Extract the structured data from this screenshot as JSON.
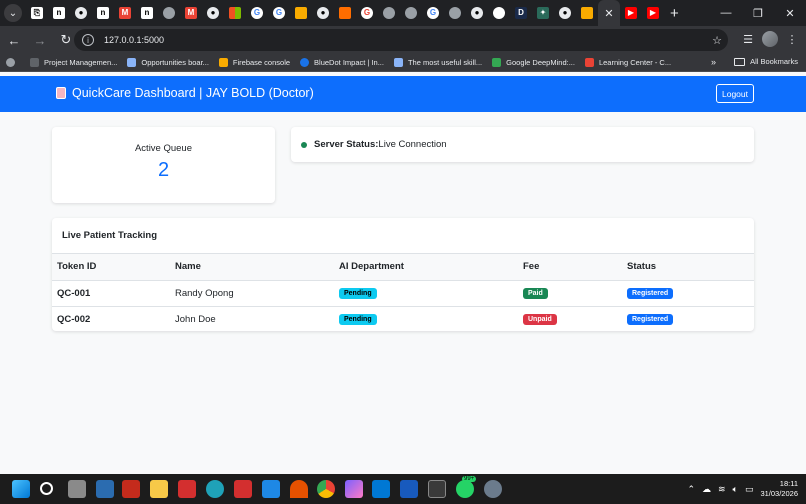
{
  "browser": {
    "url": "127.0.0.1:5000",
    "bookmarks": [
      {
        "label": "Project Managemen...",
        "color": "#5f6368"
      },
      {
        "label": "Opportunities boar...",
        "color": "#8ab4f8"
      },
      {
        "label": "Firebase console",
        "color": "#f9ab00"
      },
      {
        "label": "BlueDot Impact | In...",
        "color": "#1a73e8"
      },
      {
        "label": "The most useful skill...",
        "color": "#8ab4f8"
      },
      {
        "label": "Google DeepMind:...",
        "color": "#34a853"
      },
      {
        "label": "Learning Center - C...",
        "color": "#ea4335"
      }
    ],
    "all_bookmarks": "All Bookmarks"
  },
  "header": {
    "title": "QuickCare Dashboard | JAY BOLD (Doctor)",
    "logout": "Logout"
  },
  "queue": {
    "title": "Active Queue",
    "value": "2"
  },
  "server": {
    "label": "Server Status:",
    "text": "Live Connection"
  },
  "tracking": {
    "title": "Live Patient Tracking",
    "columns": [
      "Token ID",
      "Name",
      "AI Department",
      "Fee",
      "Status"
    ],
    "rows": [
      {
        "token": "QC-001",
        "name": "Randy Opong",
        "department": "Pending",
        "fee": "Paid",
        "status": "Registered"
      },
      {
        "token": "QC-002",
        "name": "John Doe",
        "department": "Pending",
        "fee": "Unpaid",
        "status": "Registered"
      }
    ]
  },
  "taskbar": {
    "time": "18:11",
    "date": "31/03/2026",
    "badge": "99+"
  },
  "colors": {
    "primary": "#0d6efd",
    "success": "#198754",
    "danger": "#dc3545",
    "info": "#0dcaf0"
  }
}
